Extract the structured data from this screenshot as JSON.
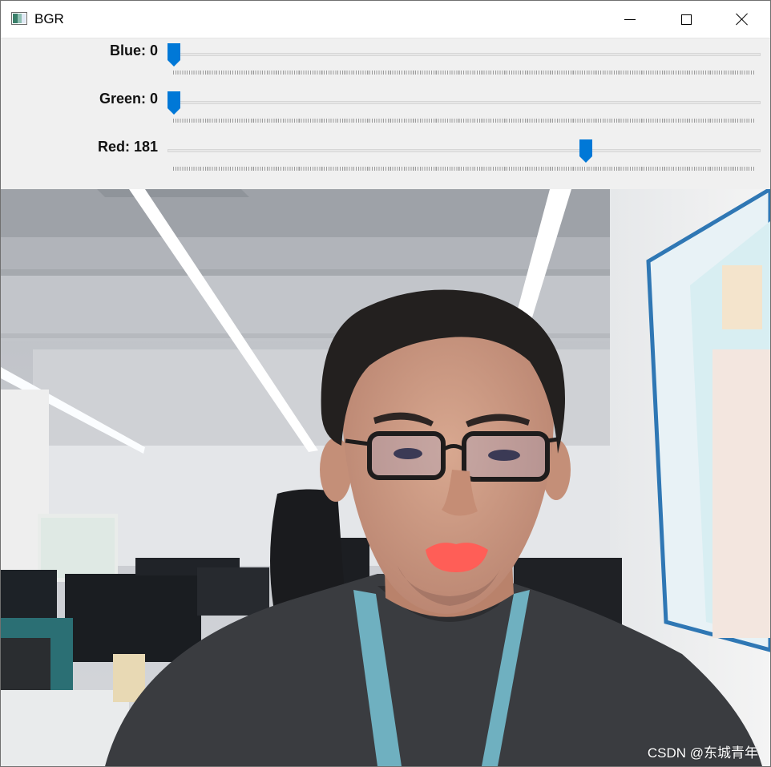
{
  "window": {
    "title": "BGR",
    "icon": "opencv-window-icon",
    "controls": [
      "minimize-icon",
      "maximize-icon",
      "close-icon"
    ]
  },
  "trackbars": [
    {
      "name": "Blue",
      "label": "Blue: 0",
      "value": 0,
      "max": 255,
      "color": "#0078d7"
    },
    {
      "name": "Green",
      "label": "Green: 0",
      "value": 0,
      "max": 255,
      "color": "#0078d7"
    },
    {
      "name": "Red",
      "label": "Red: 181",
      "value": 181,
      "max": 255,
      "color": "#0078d7"
    }
  ],
  "image": {
    "description_icon": "webcam-frame",
    "lip_color": "#ff5e57"
  },
  "watermark": "CSDN @东城青年"
}
